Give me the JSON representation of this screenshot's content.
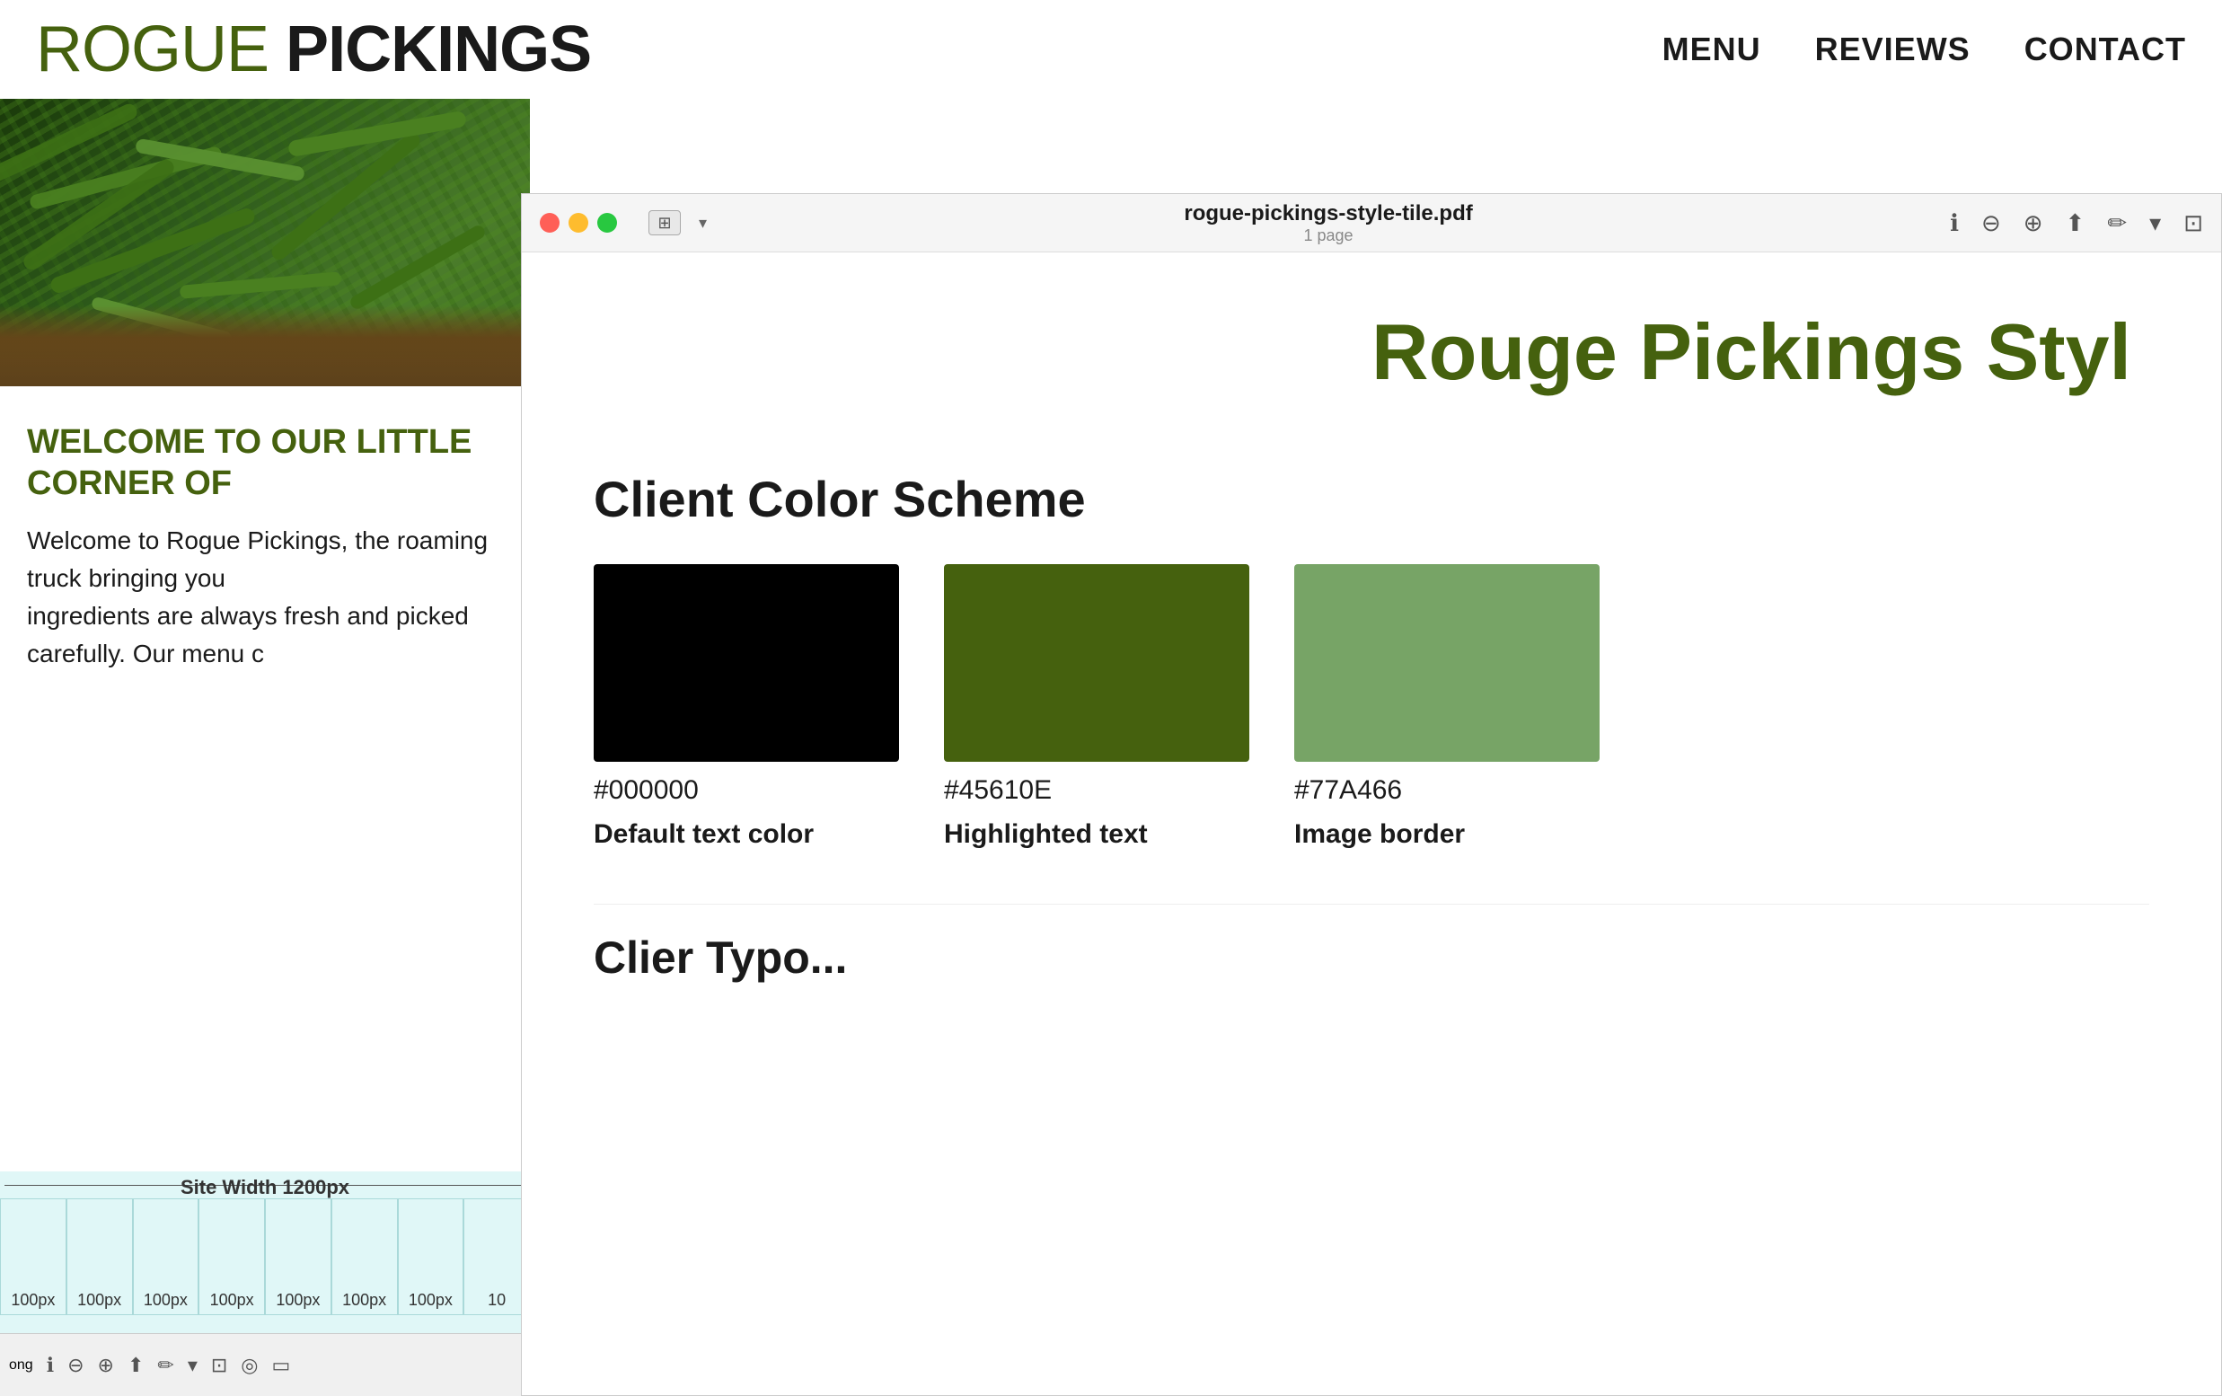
{
  "header": {
    "logo_rogue": "ROGUE",
    "logo_pickings": "PICKINGS",
    "nav": {
      "menu": "MENU",
      "reviews": "REVIEWS",
      "contact": "CONTACT"
    }
  },
  "website": {
    "welcome_heading": "WELCOME TO OUR LITTLE CORNER OF",
    "welcome_text_1": "Welcome to Rogue Pickings, the roaming truck bringing you",
    "welcome_text_2": "ingredients are always fresh and picked carefully. Our menu c"
  },
  "grid": {
    "site_width_label": "Site Width 1200px",
    "columns": [
      "100px",
      "100px",
      "100px",
      "100px",
      "100px",
      "100px",
      "100px",
      "10"
    ]
  },
  "pdf": {
    "filename": "rogue-pickings-style-tile.pdf",
    "pages": "1 page",
    "title": "Rouge Pickings Styl",
    "color_scheme_heading": "Client Color Scheme",
    "colors": [
      {
        "hex": "#000000",
        "label": "Default text color",
        "css": "#000000"
      },
      {
        "hex": "#45610E",
        "label": "Highlighted text",
        "css": "#45610E"
      },
      {
        "hex": "#77A466",
        "label": "Image border",
        "css": "#77A466"
      }
    ],
    "next_section": "Clier Typo..."
  },
  "toolbar_bottom": {
    "text": "ong"
  }
}
